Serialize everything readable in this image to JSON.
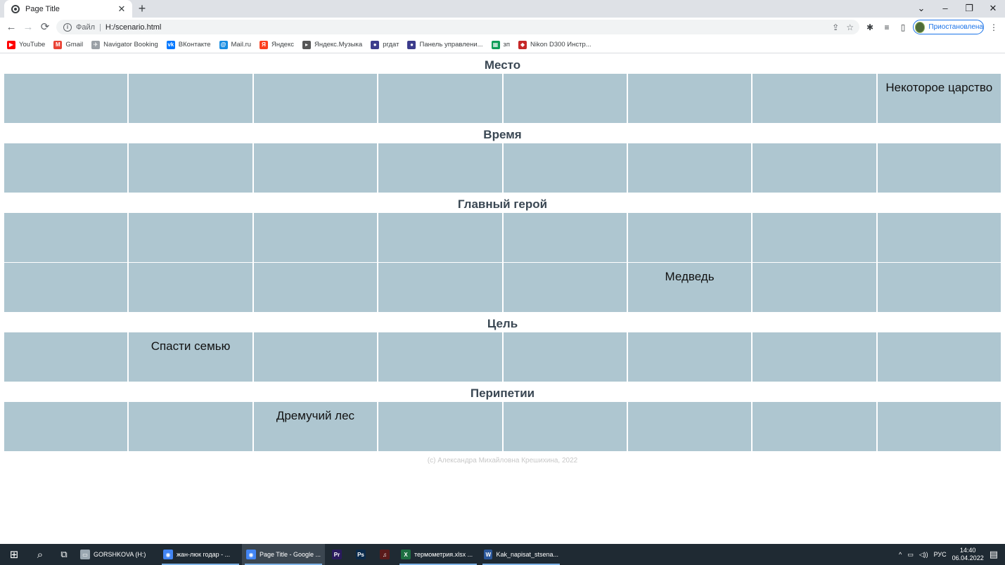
{
  "browser": {
    "tab_title": "Page Title",
    "tab_close": "✕",
    "new_tab": "+",
    "window_controls": {
      "chevron": "⌄",
      "minimize": "–",
      "restore": "❐",
      "close": "✕"
    },
    "nav": {
      "back": "←",
      "forward": "→",
      "reload": "⟳"
    },
    "omnibox": {
      "info": "i",
      "scheme": "Файл",
      "separator": "|",
      "url": "H:/scenario.html"
    },
    "toolbar_icons": {
      "share": "⇪",
      "star": "☆",
      "extensions": "✱",
      "reading_list": "≡",
      "side_panel": "▯",
      "menu": "⋮"
    },
    "profile_label": "Приостановлена"
  },
  "bookmarks": [
    {
      "label": "YouTube",
      "icon": "youtube-icon",
      "color": "#ff0000",
      "glyph": "▶"
    },
    {
      "label": "Gmail",
      "icon": "gmail-icon",
      "color": "#ea4335",
      "glyph": "M"
    },
    {
      "label": "Navigator Booking",
      "icon": "navigator-icon",
      "color": "#9aa0a6",
      "glyph": "✈"
    },
    {
      "label": "ВКонтакте",
      "icon": "vk-icon",
      "color": "#0077ff",
      "glyph": "vk"
    },
    {
      "label": "Mail.ru",
      "icon": "mailru-icon",
      "color": "#168de2",
      "glyph": "@"
    },
    {
      "label": "Яндекс",
      "icon": "yandex-icon",
      "color": "#fc3f1d",
      "glyph": "Я"
    },
    {
      "label": "Яндекс.Музыка",
      "icon": "yandex-music-icon",
      "color": "#555555",
      "glyph": "▸"
    },
    {
      "label": "ргдат",
      "icon": "rgdat-icon",
      "color": "#3c3c8c",
      "glyph": "●"
    },
    {
      "label": "Панель управлени...",
      "icon": "control-panel-icon",
      "color": "#3c3c8c",
      "glyph": "●"
    },
    {
      "label": "зп",
      "icon": "sheets-icon",
      "color": "#0f9d58",
      "glyph": "▦"
    },
    {
      "label": "Nikon D300 Инстр...",
      "icon": "nikon-icon",
      "color": "#c62828",
      "glyph": "◆"
    }
  ],
  "page": {
    "sections": [
      {
        "title": "Место",
        "rows": [
          [
            "",
            "",
            "",
            "",
            "",
            "",
            "",
            "Некоторое царство"
          ]
        ]
      },
      {
        "title": "Время",
        "rows": [
          [
            "",
            "",
            "",
            "",
            "",
            "",
            "",
            ""
          ]
        ]
      },
      {
        "title": "Главный герой",
        "rows": [
          [
            "",
            "",
            "",
            "",
            "",
            "",
            "",
            ""
          ],
          [
            "",
            "",
            "",
            "",
            "",
            "Медведь",
            "",
            ""
          ]
        ]
      },
      {
        "title": "Цель",
        "rows": [
          [
            "",
            "Спасти семью",
            "",
            "",
            "",
            "",
            "",
            ""
          ]
        ]
      },
      {
        "title": "Перипетии",
        "rows": [
          [
            "",
            "",
            "Дремучий лес",
            "",
            "",
            "",
            "",
            ""
          ]
        ]
      }
    ],
    "footer": "(c) Александра Михайловна Крешихина, 2022",
    "cell_color": "#aec6d0",
    "title_color": "#3a4753"
  },
  "taskbar": {
    "start_glyph": "⊞",
    "search_glyph": "⌕",
    "taskview_glyph": "⧉",
    "items": [
      {
        "label": "GORSHKOVA (H:)",
        "icon": "drive-icon",
        "color": "#9aa7b1",
        "glyph": "▭",
        "active": false,
        "underline": false
      },
      {
        "label": "жан-люк годар - ...",
        "icon": "chrome-icon",
        "color": "#4285f4",
        "glyph": "◉",
        "active": false,
        "underline": true
      },
      {
        "label": "Page Title - Google ...",
        "icon": "chrome-icon",
        "color": "#4285f4",
        "glyph": "◉",
        "active": true,
        "underline": true
      },
      {
        "label": "",
        "icon": "premiere-icon",
        "color": "#2a1a5e",
        "glyph": "Pr",
        "active": false,
        "underline": false
      },
      {
        "label": "",
        "icon": "photoshop-icon",
        "color": "#0b2a4a",
        "glyph": "Ps",
        "active": false,
        "underline": false
      },
      {
        "label": "",
        "icon": "app-icon",
        "color": "#5a1a1a",
        "glyph": "♫",
        "active": false,
        "underline": false
      },
      {
        "label": "термометрия.xlsx ...",
        "icon": "excel-icon",
        "color": "#1d6f42",
        "glyph": "X",
        "active": false,
        "underline": true
      },
      {
        "label": "Kak_napisat_stsena...",
        "icon": "word-icon",
        "color": "#2b579a",
        "glyph": "W",
        "active": false,
        "underline": true
      }
    ],
    "tray": {
      "chevron": "^",
      "network": "▭",
      "volume": "◁))",
      "lang": "РУС",
      "time": "14:40",
      "date": "06.04.2022",
      "notifications": "▤"
    }
  }
}
